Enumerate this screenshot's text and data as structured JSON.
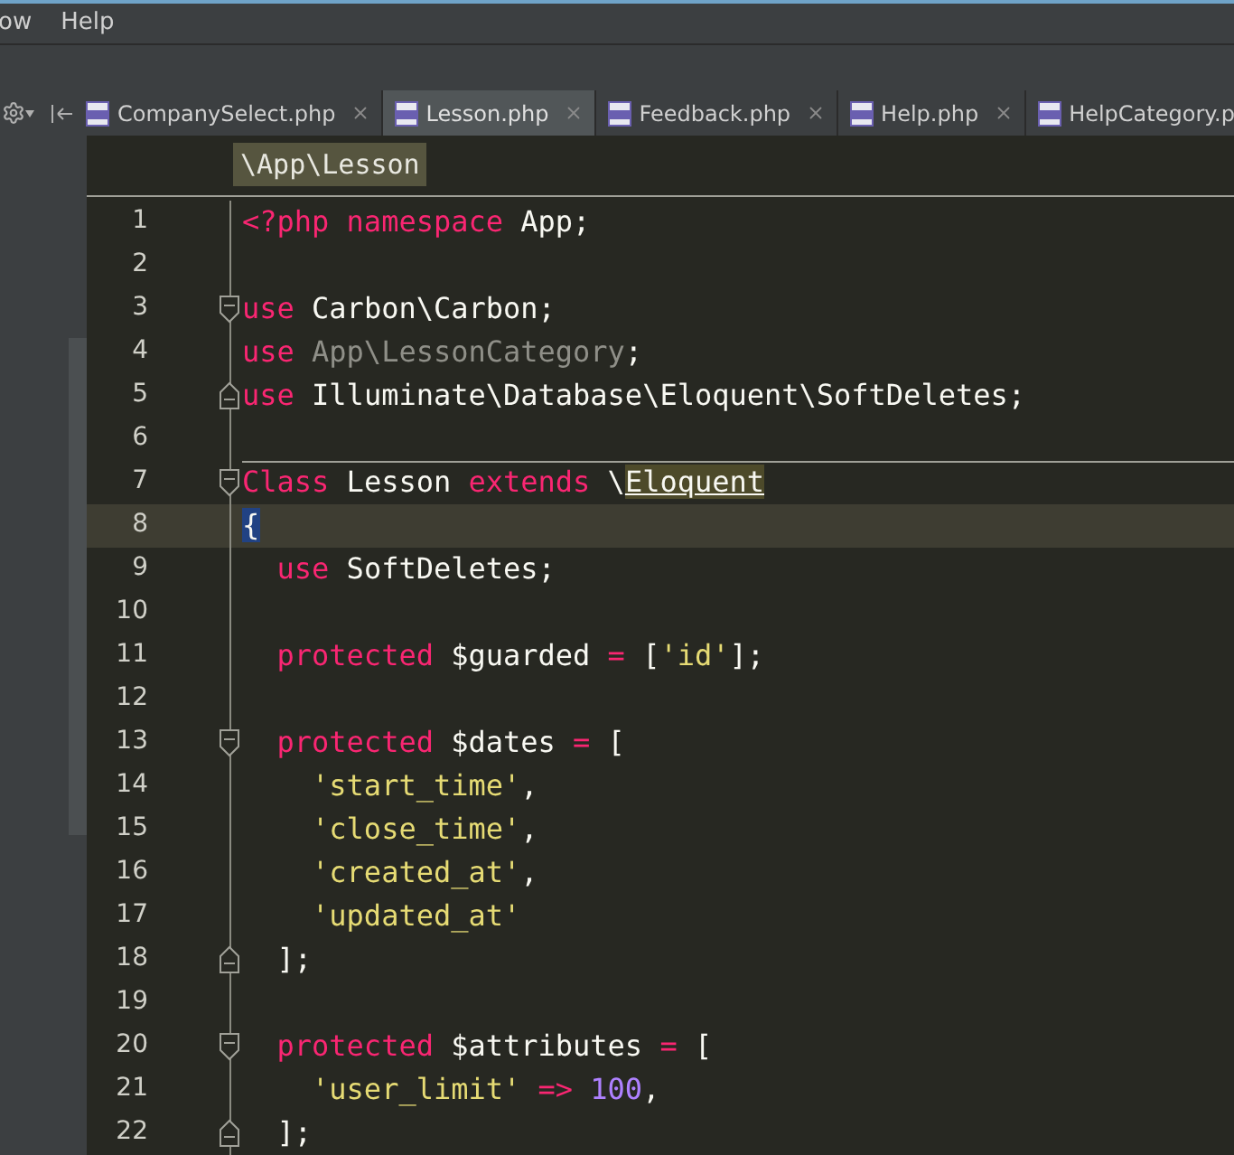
{
  "menu": [
    "ow",
    "Help"
  ],
  "tabs": [
    {
      "label": "CompanySelect.php",
      "selected": false,
      "closable": true
    },
    {
      "label": "Lesson.php",
      "selected": true,
      "closable": true
    },
    {
      "label": "Feedback.php",
      "selected": false,
      "closable": true
    },
    {
      "label": "Help.php",
      "selected": false,
      "closable": true
    },
    {
      "label": "HelpCategory.p",
      "selected": false,
      "closable": false
    }
  ],
  "breadcrumb": "\\App\\Lesson",
  "lines": [
    {
      "number": "1",
      "tokens": [
        {
          "t": "<?php ",
          "kind": "kw"
        },
        {
          "t": "namespace ",
          "kind": "kw"
        },
        {
          "t": "App;",
          "kind": "plain"
        }
      ]
    },
    {
      "number": "2"
    },
    {
      "number": "3",
      "kind": "fold-start",
      "tokens": [
        {
          "t": "use",
          "kind": "kw"
        },
        {
          "t": " Carbon\\Carbon;",
          "kind": "plain"
        }
      ]
    },
    {
      "number": "4",
      "tokens": [
        {
          "t": "use ",
          "kind": "kw"
        },
        {
          "t": "App\\LessonCategory",
          "kind": "dim"
        },
        {
          "t": ";",
          "kind": "plain"
        }
      ]
    },
    {
      "number": "5",
      "kind": "fold-end",
      "tokens": [
        {
          "t": "use",
          "kind": "kw"
        },
        {
          "t": " Illuminate\\Database\\Eloquent\\SoftDeletes;",
          "kind": "plain"
        }
      ]
    },
    {
      "number": "6"
    },
    {
      "number": "7",
      "kind": "fold-start",
      "separator": true,
      "tokens": [
        {
          "t": "Class",
          "kind": "kw"
        },
        {
          "t": " Lesson ",
          "kind": "plain"
        },
        {
          "t": "extends",
          "kind": "kw"
        },
        {
          "t": " \\",
          "kind": "plain"
        },
        {
          "t": "Eloquent",
          "kind": "link"
        }
      ]
    },
    {
      "number": "8",
      "current": true,
      "tokens": [
        {
          "t": "{",
          "kind": "brace"
        }
      ]
    },
    {
      "number": "9",
      "tokens": [
        {
          "t": "  use",
          "kind": "kw"
        },
        {
          "t": " SoftDeletes;",
          "kind": "plain"
        }
      ]
    },
    {
      "number": "10"
    },
    {
      "number": "11",
      "tokens": [
        {
          "t": "  protected",
          "kind": "kw"
        },
        {
          "t": " $guarded ",
          "kind": "plain"
        },
        {
          "t": "=",
          "kind": "kw"
        },
        {
          "t": " [",
          "kind": "plain"
        },
        {
          "t": "'id'",
          "kind": "str"
        },
        {
          "t": "];",
          "kind": "plain"
        }
      ]
    },
    {
      "number": "12"
    },
    {
      "number": "13",
      "kind": "fold-start",
      "tokens": [
        {
          "t": "  protected",
          "kind": "kw"
        },
        {
          "t": " $dates ",
          "kind": "plain"
        },
        {
          "t": "=",
          "kind": "kw"
        },
        {
          "t": " [",
          "kind": "plain"
        }
      ]
    },
    {
      "number": "14",
      "tokens": [
        {
          "t": "    'start_time'",
          "kind": "str"
        },
        {
          "t": ",",
          "kind": "plain"
        }
      ]
    },
    {
      "number": "15",
      "tokens": [
        {
          "t": "    'close_time'",
          "kind": "str"
        },
        {
          "t": ",",
          "kind": "plain"
        }
      ]
    },
    {
      "number": "16",
      "tokens": [
        {
          "t": "    'created_at'",
          "kind": "str"
        },
        {
          "t": ",",
          "kind": "plain"
        }
      ]
    },
    {
      "number": "17",
      "tokens": [
        {
          "t": "    'updated_at'",
          "kind": "str"
        }
      ]
    },
    {
      "number": "18",
      "kind": "fold-end",
      "tokens": [
        {
          "t": "  ];",
          "kind": "plain"
        }
      ]
    },
    {
      "number": "19"
    },
    {
      "number": "20",
      "kind": "fold-start",
      "tokens": [
        {
          "t": "  protected",
          "kind": "kw"
        },
        {
          "t": " $attributes ",
          "kind": "plain"
        },
        {
          "t": "=",
          "kind": "kw"
        },
        {
          "t": " [",
          "kind": "plain"
        }
      ]
    },
    {
      "number": "21",
      "tokens": [
        {
          "t": "    'user_limit'",
          "kind": "str"
        },
        {
          "t": " =>",
          "kind": "kw"
        },
        {
          "t": " 100",
          "kind": "num"
        },
        {
          "t": ",",
          "kind": "plain"
        }
      ]
    },
    {
      "number": "22",
      "kind": "fold-end",
      "tokens": [
        {
          "t": "  ];",
          "kind": "plain"
        }
      ]
    }
  ]
}
